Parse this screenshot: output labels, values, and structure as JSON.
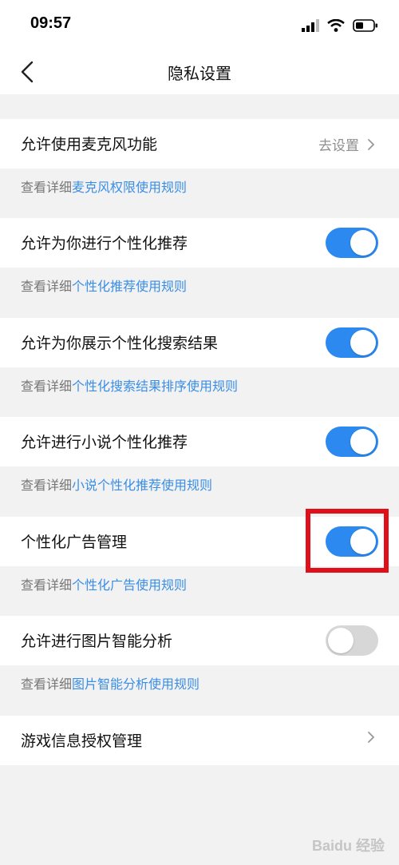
{
  "status_bar": {
    "time": "09:57"
  },
  "nav": {
    "title": "隐私设置"
  },
  "rows": [
    {
      "label": "允许使用麦克风功能",
      "right_text": "去设置",
      "hint_prefix": "查看详细",
      "hint_link": "麦克风权限使用规则"
    },
    {
      "label": "允许为你进行个性化推荐",
      "toggle_on": true,
      "hint_prefix": "查看详细",
      "hint_link": "个性化推荐使用规则"
    },
    {
      "label": "允许为你展示个性化搜索结果",
      "toggle_on": true,
      "hint_prefix": "查看详细",
      "hint_link": "个性化搜索结果排序使用规则"
    },
    {
      "label": "允许进行小说个性化推荐",
      "toggle_on": true,
      "hint_prefix": "查看详细",
      "hint_link": "小说个性化推荐使用规则"
    },
    {
      "label": "个性化广告管理",
      "toggle_on": true,
      "hint_prefix": "查看详细",
      "hint_link": "个性化广告使用规则"
    },
    {
      "label": "允许进行图片智能分析",
      "toggle_on": false,
      "hint_prefix": "查看详细",
      "hint_link": "图片智能分析使用规则"
    },
    {
      "label": "游戏信息授权管理"
    }
  ],
  "colors": {
    "accent": "#2b89f0",
    "link": "#3a8ee6",
    "highlight": "#e0101a"
  },
  "watermark": {
    "text": "Baidu 经验"
  }
}
